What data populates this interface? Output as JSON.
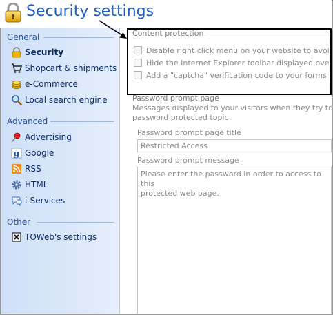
{
  "header": {
    "title": "Security settings"
  },
  "sidebar": {
    "sections": [
      {
        "label": "General",
        "items": [
          {
            "label": "Security",
            "icon": "lock-icon",
            "active": true
          },
          {
            "label": "Shopcart & shipments",
            "icon": "cart-icon"
          },
          {
            "label": "e-Commerce",
            "icon": "coins-icon"
          },
          {
            "label": "Local search engine",
            "icon": "magnifier-icon"
          }
        ]
      },
      {
        "label": "Advanced",
        "items": [
          {
            "label": "Advertising",
            "icon": "pushpin-icon"
          },
          {
            "label": "Google",
            "icon": "google-icon"
          },
          {
            "label": "RSS",
            "icon": "rss-icon"
          },
          {
            "label": "HTML",
            "icon": "gear-icon"
          },
          {
            "label": "i-Services",
            "icon": "chat-icon"
          }
        ]
      },
      {
        "label": "Other",
        "items": [
          {
            "label": "TOWeb's settings",
            "icon": "close-box-icon"
          }
        ]
      }
    ]
  },
  "content_protection": {
    "title": "Content protection",
    "options": [
      "Disable right click menu on your website to avoid leec",
      "Hide the Internet Explorer toolbar displayed over the p",
      "Add a \"captcha\" verification code to your forms"
    ]
  },
  "password_prompt": {
    "title": "Password prompt page",
    "description_line1": "Messages displayed to your visitors when they try to acce",
    "description_line2": "password protected topic",
    "page_title_label": "Password prompt page title",
    "page_title_value": "Restricted Access",
    "message_label": "Password prompt message",
    "message_line1": "Please enter the password in order to access to this",
    "message_line2": "protected web page."
  },
  "colors": {
    "title_blue": "#1f5fbf",
    "sidebar_bg": "#d6e4f8",
    "callout_border": "#000000"
  }
}
